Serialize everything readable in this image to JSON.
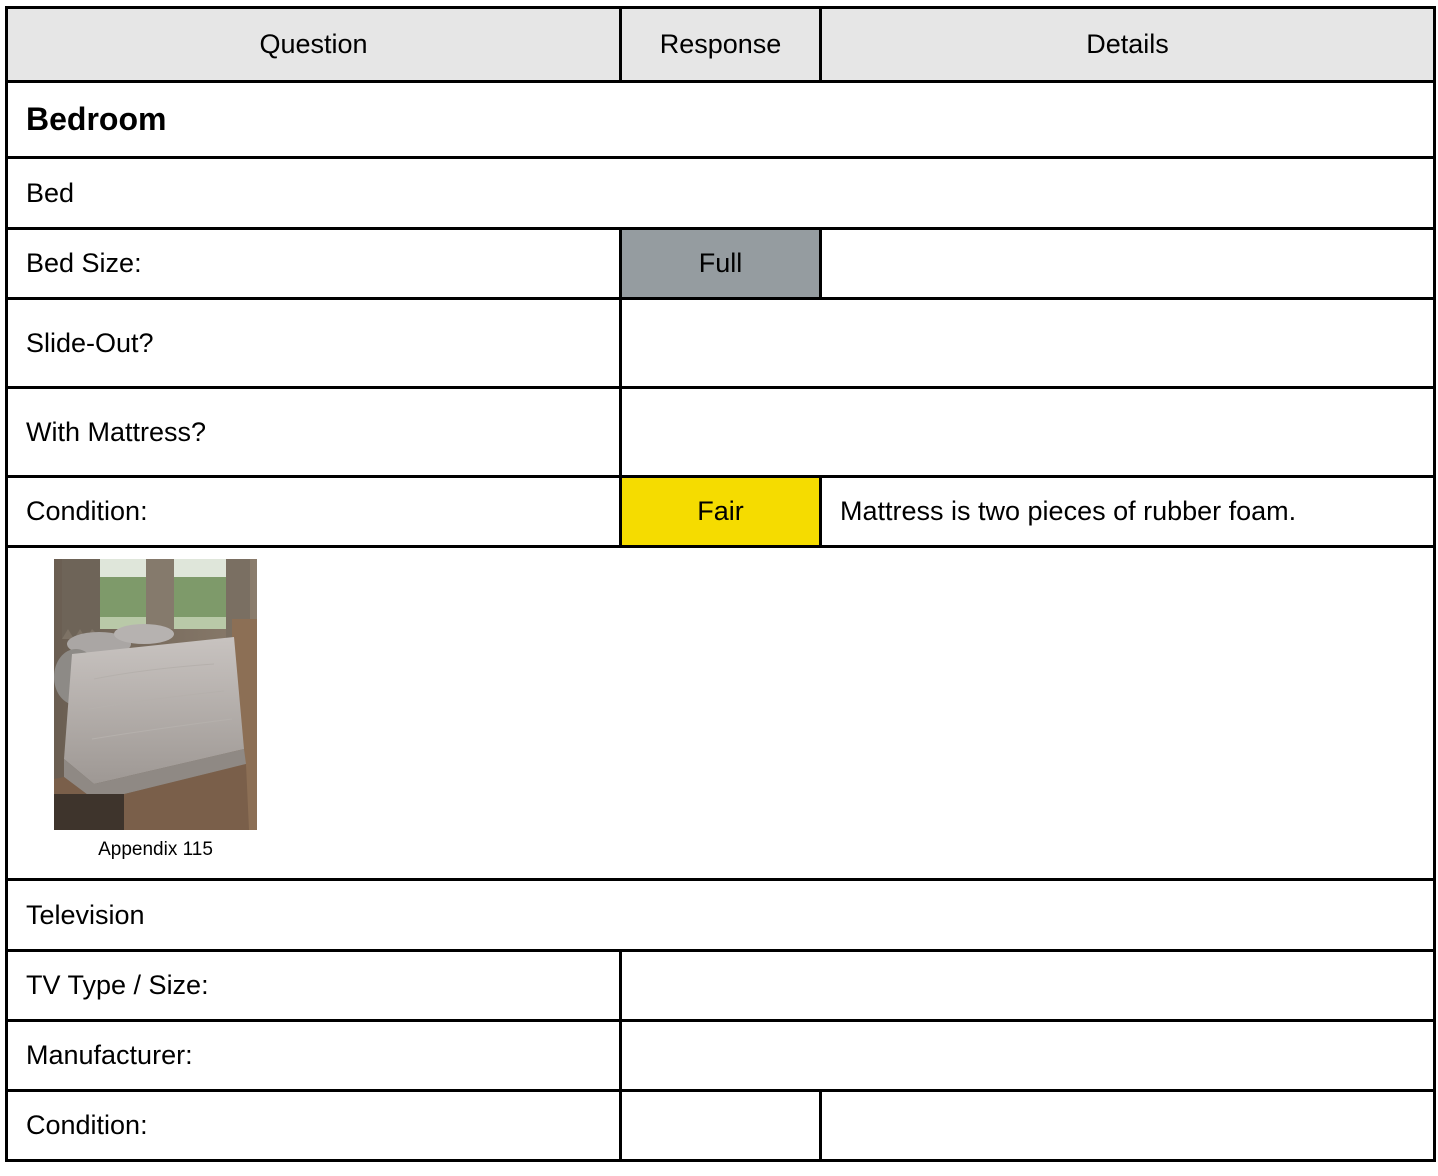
{
  "header": {
    "question": "Question",
    "response": "Response",
    "details": "Details",
    "bg_color": "#e6e6e6"
  },
  "section": {
    "title": "Bedroom"
  },
  "bed": {
    "subheading": "Bed",
    "rows": [
      {
        "question": "Bed Size:",
        "response": "Full",
        "details": "",
        "response_color": "#959ca0"
      },
      {
        "question": "Slide-Out?",
        "response": "",
        "details": ""
      },
      {
        "question": "With Mattress?",
        "response": "",
        "details": ""
      },
      {
        "question": "Condition:",
        "response": "Fair",
        "details": "Mattress is two pieces of rubber foam.",
        "response_color": "#f5dc00"
      }
    ],
    "photo": {
      "caption": "Appendix 115"
    }
  },
  "television": {
    "subheading": "Television",
    "rows": [
      {
        "question": "TV Type / Size:",
        "response": "",
        "details": ""
      },
      {
        "question": "Manufacturer:",
        "response": "",
        "details": ""
      },
      {
        "question": "Condition:",
        "response": "",
        "details": ""
      }
    ]
  }
}
